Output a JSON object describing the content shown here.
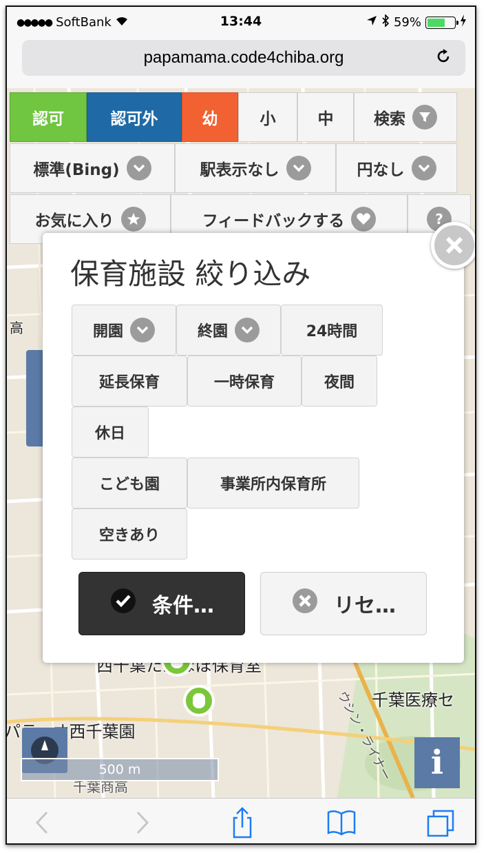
{
  "status_bar": {
    "carrier": "SoftBank",
    "time": "13:44",
    "battery": "59%",
    "battery_level": 0.59
  },
  "browser": {
    "url": "papamama.code4chiba.org",
    "reload_icon": "reload-icon"
  },
  "toolbar_row1": {
    "ninka": "認可",
    "ninkagai": "認可外",
    "you": "幼",
    "sho": "小",
    "chu": "中",
    "search": "検索"
  },
  "toolbar_row2": {
    "map_type": "標準(Bing)",
    "station": "駅表示なし",
    "circle": "円なし"
  },
  "toolbar_row3": {
    "favorites": "お気に入り",
    "feedback": "フィードバックする"
  },
  "map": {
    "labels": {
      "nursery1": "西千葉たんぽぽ保育室",
      "hospital": "千葉医療セ",
      "patio": "パティオ西千葉園",
      "line": "ウシン・ライナー",
      "shop": "千葉商高",
      "left_edge": "高"
    },
    "scale": "500 m",
    "info": "i"
  },
  "modal": {
    "title": "保育施設 絞り込み",
    "filters": {
      "open": "開園",
      "close": "終園",
      "hours24": "24時間",
      "extended": "延長保育",
      "temporary": "一時保育",
      "night": "夜間",
      "holiday": "休日",
      "kodomoen": "こども園",
      "workplace": "事業所内保育所",
      "vacancy": "空きあり"
    },
    "apply": "条件…",
    "reset": "リセ…"
  },
  "colors": {
    "green": "#70c541",
    "blue": "#1f6aa6",
    "orange": "#f26131",
    "dark": "#333333"
  }
}
